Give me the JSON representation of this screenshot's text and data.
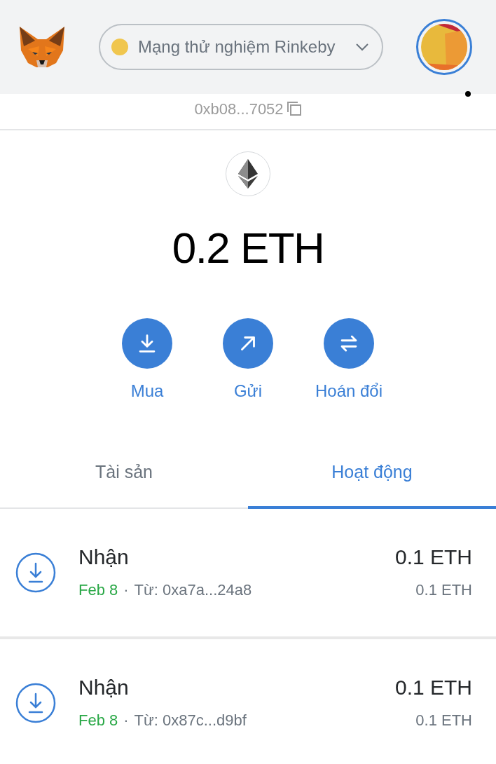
{
  "network": {
    "name": "Mạng thử nghiệm Rinkeby",
    "color": "#f0c64e"
  },
  "account": {
    "address": "0xb08...7052"
  },
  "balance": "0.2 ETH",
  "actions": [
    {
      "kind": "buy",
      "label": "Mua"
    },
    {
      "kind": "send",
      "label": "Gửi"
    },
    {
      "kind": "swap",
      "label": "Hoán đổi"
    }
  ],
  "tabs": [
    {
      "label": "Tài sản",
      "selected": false
    },
    {
      "label": "Hoạt động",
      "selected": true
    }
  ],
  "transactions": [
    {
      "title": "Nhận",
      "date": "Feb 8",
      "separator": "·",
      "from": "Từ: 0xa7a...24a8",
      "amount": "0.1 ETH",
      "secondary_amount": "0.1 ETH"
    },
    {
      "title": "Nhận",
      "date": "Feb 8",
      "separator": "·",
      "from": "Từ: 0x87c...d9bf",
      "amount": "0.1 ETH",
      "secondary_amount": "0.1 ETH"
    }
  ]
}
